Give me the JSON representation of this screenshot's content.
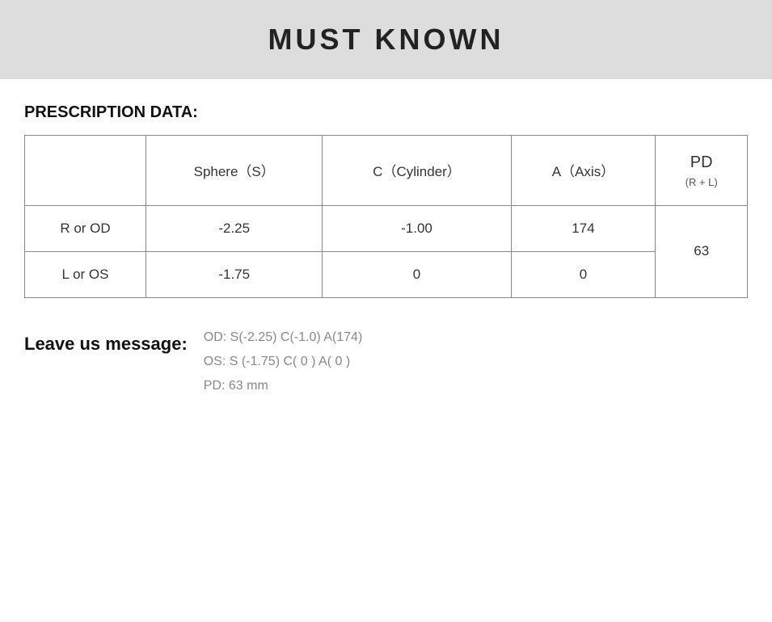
{
  "header": {
    "title": "MUST KNOWN"
  },
  "section": {
    "prescription_label": "PRESCRIPTION DATA:"
  },
  "table": {
    "columns": [
      "",
      "Sphere（S）",
      "C（Cylinder）",
      "A（Axis）",
      "PD"
    ],
    "pd_sub": "(R + L)",
    "rows": [
      {
        "label": "R or OD",
        "sphere": "-2.25",
        "cylinder": "-1.00",
        "axis": "174",
        "pd": "63"
      },
      {
        "label": "L or OS",
        "sphere": "-1.75",
        "cylinder": "0",
        "axis": "0",
        "pd": ""
      }
    ]
  },
  "leave_message": {
    "label": "Leave us message:",
    "lines": [
      "OD:  S(-2.25)    C(-1.0)   A(174)",
      "OS:  S (-1.75)    C( 0 )    A( 0 )",
      "PD:  63 mm"
    ]
  }
}
